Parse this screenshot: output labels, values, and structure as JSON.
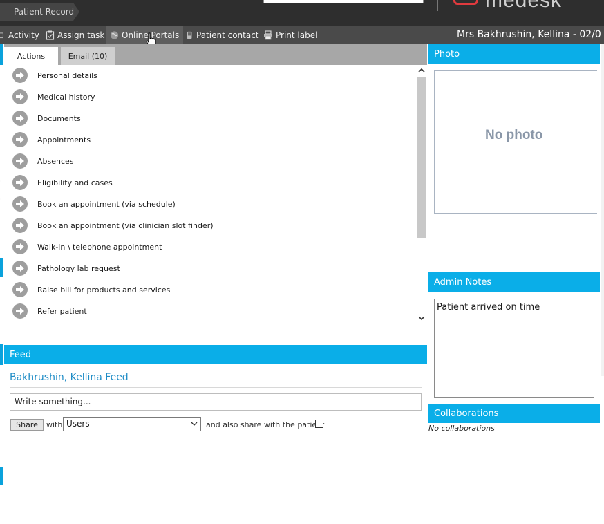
{
  "topbar": {
    "breadcrumb": "Patient Record",
    "logo_text": "medesk"
  },
  "toolbar": {
    "activity": "Activity",
    "assign_task": "Assign task",
    "online_portals": "Online Portals",
    "patient_contact": "Patient contact",
    "print_label": "Print label",
    "patient_name": "Mrs Bakhrushin, Kellina - 02/0"
  },
  "tabs": {
    "actions": "Actions",
    "email": "Email (10)"
  },
  "actions": [
    {
      "label": "Personal details"
    },
    {
      "label": "Medical history"
    },
    {
      "label": "Documents"
    },
    {
      "label": "Appointments"
    },
    {
      "label": "Absences"
    },
    {
      "label": "Eligibility and cases"
    },
    {
      "label": "Book an appointment (via schedule)"
    },
    {
      "label": "Book an appointment (via clinician slot finder)"
    },
    {
      "label": "Walk-in \\ telephone appointment"
    },
    {
      "label": "Pathology lab request"
    },
    {
      "label": "Raise bill for products and services"
    },
    {
      "label": "Refer patient"
    }
  ],
  "feed": {
    "header": "Feed",
    "title": "Bakhrushin, Kellina Feed",
    "input_value": "Write something...",
    "share_button": "Share",
    "with_label": "with",
    "share_target": "Users",
    "patient_share_label": "and also share with the patient"
  },
  "photo": {
    "header": "Photo",
    "placeholder": "No photo"
  },
  "admin_notes": {
    "header": "Admin Notes",
    "value": "Patient arrived on time"
  },
  "collaborations": {
    "header": "Collaborations",
    "empty": "No collaborations"
  },
  "colors": {
    "accent": "#0aaee8",
    "toolbar": "#4a4a4a",
    "topbar": "#2e2e2e",
    "logo": "#e03a3e"
  }
}
